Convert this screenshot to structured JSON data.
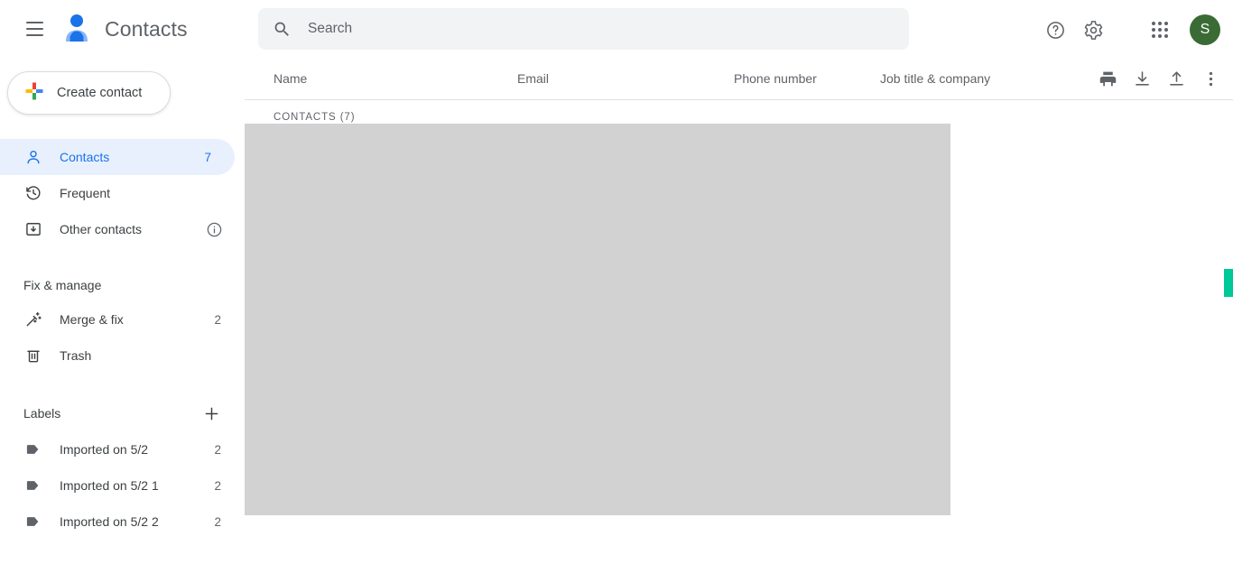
{
  "app": {
    "title": "Contacts",
    "logo_icon": "contacts-person-icon",
    "menu_icon": "hamburger-menu-icon"
  },
  "search": {
    "placeholder": "Search",
    "value": "",
    "icon": "search-icon"
  },
  "topbar_icons": [
    {
      "name": "help-icon",
      "label": "Help"
    },
    {
      "name": "settings-gear-icon",
      "label": "Settings"
    },
    {
      "name": "google-apps-icon",
      "label": "Google apps"
    }
  ],
  "account": {
    "avatar_initial": "S",
    "avatar_color": "#3a6b35"
  },
  "sidebar": {
    "create_button": {
      "label": "Create contact",
      "icon": "google-plus-icon"
    },
    "nav_items": [
      {
        "label": "Contacts",
        "count": "7",
        "icon": "person-icon",
        "active": true
      },
      {
        "label": "Frequent",
        "count": "",
        "icon": "history-clock-icon",
        "active": false
      },
      {
        "label": "Other contacts",
        "count": "",
        "icon": "archive-box-icon",
        "info_icon": "info-circle-icon",
        "active": false
      }
    ],
    "fix_manage": {
      "title": "Fix & manage",
      "items": [
        {
          "label": "Merge & fix",
          "count": "2",
          "icon": "magic-wand-icon"
        },
        {
          "label": "Trash",
          "count": "",
          "icon": "trash-icon"
        }
      ]
    },
    "labels": {
      "title": "Labels",
      "add_icon": "plus-icon",
      "items": [
        {
          "label": "Imported on 5/2",
          "count": "2",
          "icon": "label-tag-icon"
        },
        {
          "label": "Imported on 5/2 1",
          "count": "2",
          "icon": "label-tag-icon"
        },
        {
          "label": "Imported on 5/2 2",
          "count": "2",
          "icon": "label-tag-icon"
        }
      ]
    }
  },
  "table": {
    "columns": {
      "name": "Name",
      "email": "Email",
      "phone": "Phone number",
      "job": "Job title & company"
    },
    "group_label": "CONTACTS (7)",
    "actions": [
      {
        "name": "print-icon",
        "label": "Print"
      },
      {
        "name": "import-download-icon",
        "label": "Import"
      },
      {
        "name": "export-upload-icon",
        "label": "Export"
      },
      {
        "name": "more-options-icon",
        "label": "More options"
      }
    ]
  },
  "colors": {
    "accent": "#1a73e8",
    "active_pill": "#e8f0fe",
    "overlay": "#d2d2d2",
    "scrollbar": "#00c999",
    "search_bg": "#f1f3f4"
  }
}
